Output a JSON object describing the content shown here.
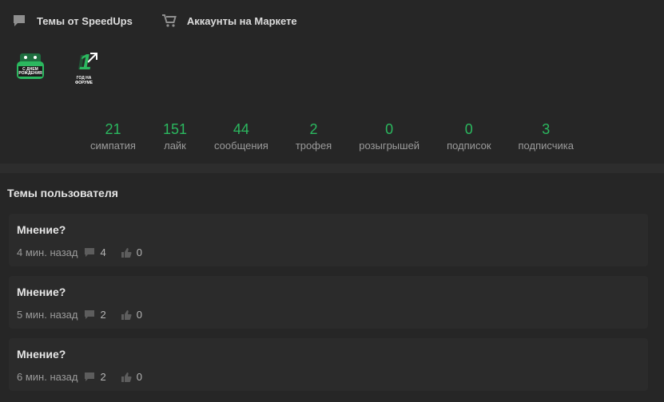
{
  "nav": [
    {
      "label": "Темы от SpeedUps",
      "icon": "chat-bubble-icon"
    },
    {
      "label": "Аккаунты на Маркете",
      "icon": "cart-icon"
    }
  ],
  "badges": [
    {
      "icon": "birthday-cake-badge-icon",
      "text": "С ДНЕМ РОЖДЕНИЯ"
    },
    {
      "icon": "one-year-badge-icon",
      "number": "1",
      "text": "ГОД НА ФОРУМЕ"
    }
  ],
  "stats": [
    {
      "value": "21",
      "label": "симпатия"
    },
    {
      "value": "151",
      "label": "лайк"
    },
    {
      "value": "44",
      "label": "сообщения"
    },
    {
      "value": "2",
      "label": "трофея"
    },
    {
      "value": "0",
      "label": "розыгрышей"
    },
    {
      "value": "0",
      "label": "подписок"
    },
    {
      "value": "3",
      "label": "подписчика"
    }
  ],
  "section": {
    "title": "Темы пользователя"
  },
  "topics": [
    {
      "title": "Мнение?",
      "time": "4 мин. назад",
      "replies": "4",
      "likes": "0"
    },
    {
      "title": "Мнение?",
      "time": "5 мин. назад",
      "replies": "2",
      "likes": "0"
    },
    {
      "title": "Мнение?",
      "time": "6 мин. назад",
      "replies": "2",
      "likes": "0"
    }
  ],
  "colors": {
    "accent": "#2bb85f",
    "background": "#262626",
    "card": "#2b2b2b"
  }
}
